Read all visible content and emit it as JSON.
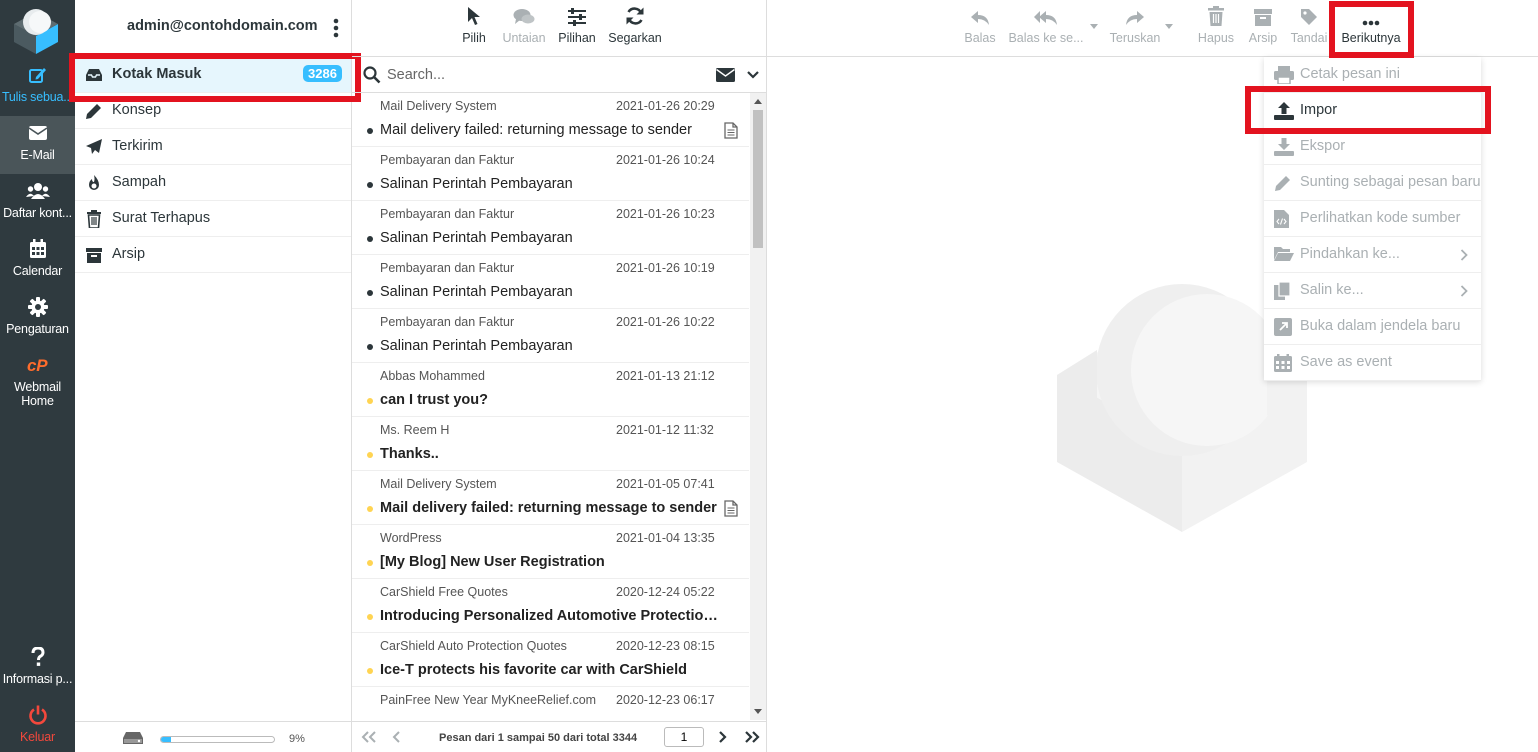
{
  "rail": {
    "items": [
      {
        "label": "Tulis sebua...",
        "icon": "compose-icon"
      },
      {
        "label": "E-Mail",
        "icon": "mail-icon"
      },
      {
        "label": "Daftar kont...",
        "icon": "contacts-icon"
      },
      {
        "label": "Calendar",
        "icon": "calendar-icon"
      },
      {
        "label": "Pengaturan",
        "icon": "gear-icon"
      },
      {
        "label": "Webmail Home",
        "icon": "cpanel-icon"
      }
    ],
    "help": "Informasi p...",
    "logout": "Keluar"
  },
  "folders": {
    "account": "admin@contohdomain.com",
    "items": [
      {
        "name": "Kotak Masuk",
        "badge": "3286"
      },
      {
        "name": "Konsep"
      },
      {
        "name": "Terkirim"
      },
      {
        "name": "Sampah"
      },
      {
        "name": "Surat Terhapus"
      },
      {
        "name": "Arsip"
      }
    ],
    "quota_fraction": 0.09,
    "quota_label": "9%"
  },
  "list_toolbar": {
    "select": "Pilih",
    "threads": "Untaian",
    "options": "Pilihan",
    "refresh": "Segarkan"
  },
  "search": {
    "placeholder": "Search..."
  },
  "messages": [
    {
      "from": "Mail Delivery System",
      "date": "2021-01-26 20:29",
      "subject": "Mail delivery failed: returning message to sender",
      "unread": false,
      "flag": false,
      "attachment": true
    },
    {
      "from": "Pembayaran dan Faktur",
      "date": "2021-01-26 10:24",
      "subject": "Salinan Perintah Pembayaran",
      "unread": false,
      "flag": false,
      "attachment": false
    },
    {
      "from": "Pembayaran dan Faktur",
      "date": "2021-01-26 10:23",
      "subject": "Salinan Perintah Pembayaran",
      "unread": false,
      "flag": false,
      "attachment": false
    },
    {
      "from": "Pembayaran dan Faktur",
      "date": "2021-01-26 10:19",
      "subject": "Salinan Perintah Pembayaran",
      "unread": false,
      "flag": false,
      "attachment": false
    },
    {
      "from": "Pembayaran dan Faktur",
      "date": "2021-01-26 10:22",
      "subject": "Salinan Perintah Pembayaran",
      "unread": false,
      "flag": false,
      "attachment": false
    },
    {
      "from": "Abbas Mohammed",
      "date": "2021-01-13 21:12",
      "subject": "can I trust you?",
      "unread": true,
      "flag": true,
      "attachment": false
    },
    {
      "from": "Ms. Reem H",
      "date": "2021-01-12 11:32",
      "subject": "Thanks..",
      "unread": true,
      "flag": true,
      "attachment": false
    },
    {
      "from": "Mail Delivery System",
      "date": "2021-01-05 07:41",
      "subject": "Mail delivery failed: returning message to sender",
      "unread": true,
      "flag": true,
      "attachment": true
    },
    {
      "from": "WordPress",
      "date": "2021-01-04 13:35",
      "subject": "[My Blog] New User Registration",
      "unread": true,
      "flag": true,
      "attachment": false
    },
    {
      "from": "CarShield Free Quotes",
      "date": "2020-12-24 05:22",
      "subject": "Introducing Personalized Automotive Protection Pl...",
      "unread": true,
      "flag": true,
      "attachment": false
    },
    {
      "from": "CarShield Auto Protection Quotes",
      "date": "2020-12-23 08:15",
      "subject": "Ice-T protects his favorite car with CarShield",
      "unread": true,
      "flag": true,
      "attachment": false
    },
    {
      "from": "PainFree New Year MyKneeRelief.com",
      "date": "2020-12-23 06:17",
      "subject": "",
      "unread": true,
      "flag": true,
      "attachment": false
    }
  ],
  "pager": {
    "info": "Pesan dari 1 sampai 50 dari total 3344",
    "page": "1"
  },
  "content_toolbar": {
    "reply": "Balas",
    "reply_all": "Balas ke se...",
    "forward": "Teruskan",
    "delete": "Hapus",
    "archive": "Arsip",
    "mark": "Tandai",
    "more": "Berikutnya"
  },
  "more_menu": [
    {
      "label": "Cetak pesan ini",
      "icon": "print-icon",
      "enabled": false
    },
    {
      "label": "Impor",
      "icon": "upload-icon",
      "enabled": true
    },
    {
      "label": "Ekspor",
      "icon": "download-icon",
      "enabled": false
    },
    {
      "label": "Sunting sebagai pesan baru",
      "icon": "pencil-icon",
      "enabled": false
    },
    {
      "label": "Perlihatkan kode sumber",
      "icon": "code-file-icon",
      "enabled": false
    },
    {
      "label": "Pindahkan ke...",
      "icon": "folder-open-icon",
      "enabled": false
    },
    {
      "label": "Salin ke...",
      "icon": "copy-icon",
      "enabled": false
    },
    {
      "label": "Buka dalam jendela baru",
      "icon": "external-window-icon",
      "enabled": false
    },
    {
      "label": "Save as event",
      "icon": "calendar-icon",
      "enabled": false
    }
  ],
  "colors": {
    "accent": "#37beff",
    "rail": "#2f3a3f",
    "highlight": "#e3131f",
    "flag": "#ffd452"
  }
}
